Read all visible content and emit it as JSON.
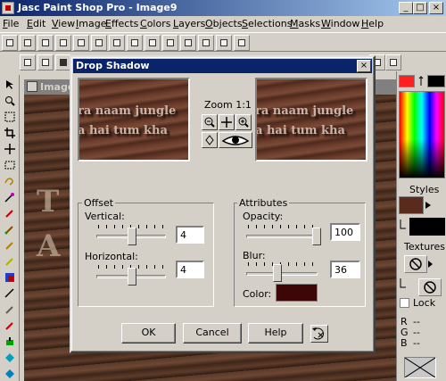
{
  "app": {
    "title": "Jasc Paint Shop Pro - Image9"
  },
  "menu": [
    "File",
    "Edit",
    "View",
    "Image",
    "Effects",
    "Colors",
    "Layers",
    "Objects",
    "Selections",
    "Masks",
    "Window",
    "Help"
  ],
  "image_window": {
    "title": "Image",
    "overlay_lines": [
      "T",
      "A"
    ]
  },
  "dialog": {
    "title": "Drop Shadow",
    "close_label": "×",
    "zoom_label": "Zoom 1:1",
    "preview_text": [
      "ra naam jungle",
      "a hai tum kha"
    ],
    "offset": {
      "group_label": "Offset",
      "vertical_label": "Vertical:",
      "vertical_value": "4",
      "horizontal_label": "Horizontal:",
      "horizontal_value": "4"
    },
    "attributes": {
      "group_label": "Attributes",
      "opacity_label": "Opacity:",
      "opacity_value": "100",
      "blur_label": "Blur:",
      "blur_value": "36",
      "color_label": "Color:",
      "shadow_color": "#3d0707"
    },
    "buttons": {
      "ok": "OK",
      "cancel": "Cancel",
      "help": "Help"
    }
  },
  "palette": {
    "styles_label": "Styles",
    "textures_label": "Textures",
    "lock_label": "Lock",
    "rgb_labels": [
      "R",
      "G",
      "B"
    ],
    "rgb_values": [
      "--",
      "--",
      "--"
    ]
  },
  "colors": {
    "titlebar": "#0a246a",
    "wood": "#5a3a28"
  }
}
